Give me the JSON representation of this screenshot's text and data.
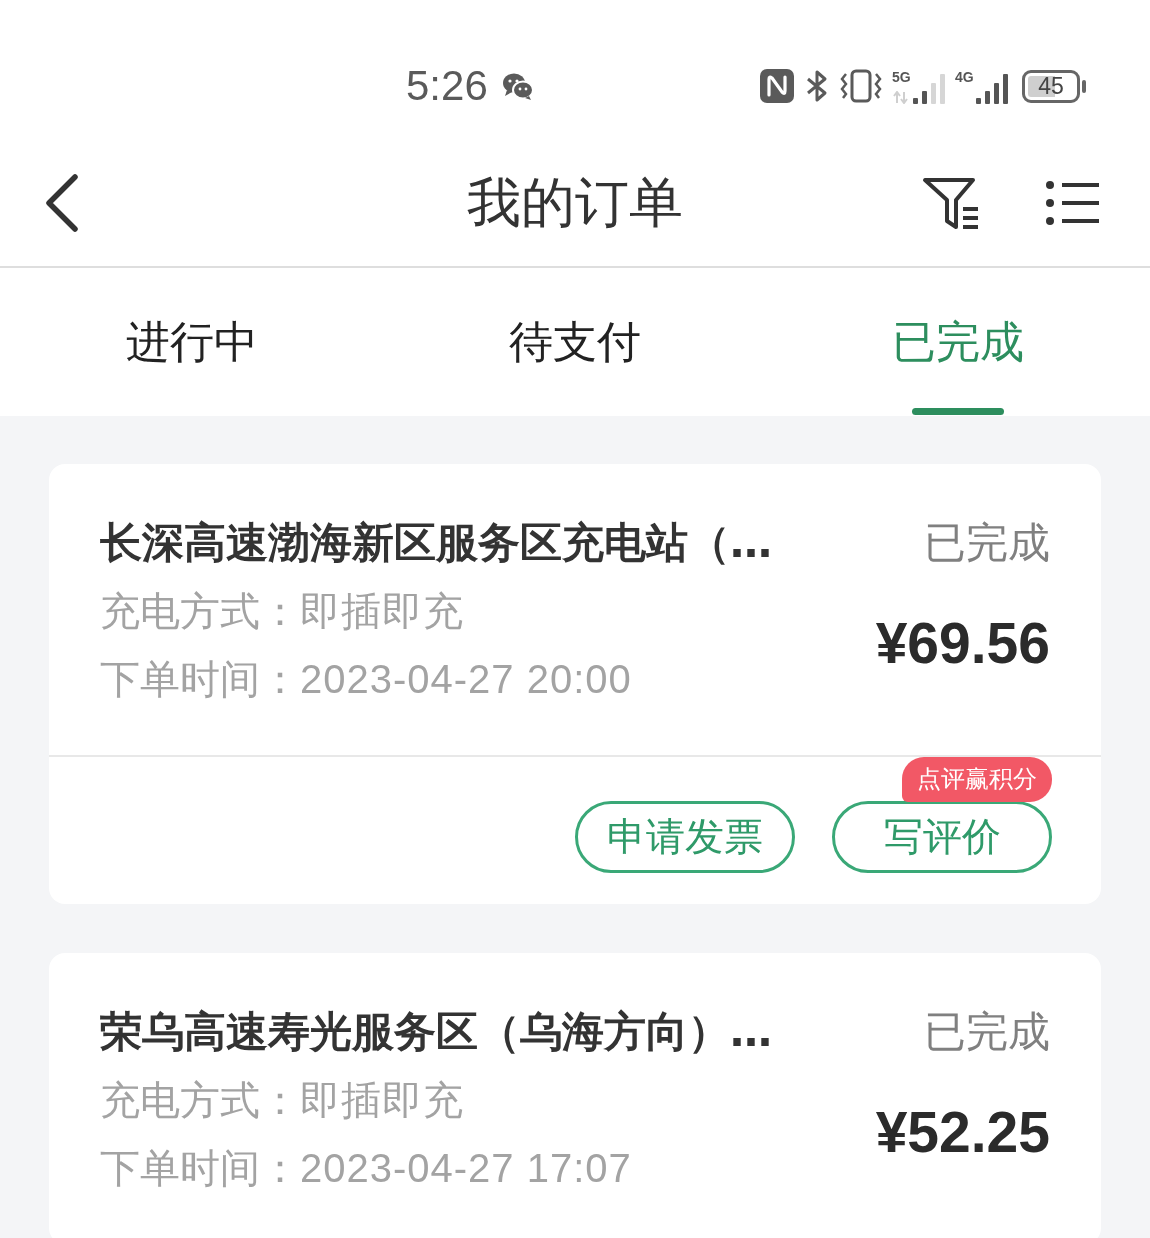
{
  "status_bar": {
    "time": "5:26",
    "signals": [
      {
        "kind": "mobile-data",
        "label": "5G"
      },
      {
        "kind": "signal",
        "label": "4G"
      }
    ],
    "battery": "45"
  },
  "header": {
    "title": "我的订单"
  },
  "tabs": [
    {
      "label": "进行中",
      "selected": false
    },
    {
      "label": "待支付",
      "selected": false
    },
    {
      "label": "已完成",
      "selected": true
    }
  ],
  "orders": [
    {
      "station": "长深高速渤海新区服务区充电站（…",
      "status": "已完成",
      "details": [
        {
          "label": "充电方式：",
          "value": "即插即充"
        },
        {
          "label": "下单时间：",
          "value": "2023-04-27 20:00"
        }
      ],
      "price": "¥69.56",
      "actions": [
        {
          "label": "申请发票"
        },
        {
          "label": "写评价",
          "badge": "点评赢积分"
        }
      ]
    },
    {
      "station": "荣乌高速寿光服务区（乌海方向）…",
      "status": "已完成",
      "details": [
        {
          "label": "充电方式：",
          "value": "即插即充"
        },
        {
          "label": "下单时间：",
          "value": "2023-04-27 17:07"
        }
      ],
      "price": "¥52.25"
    }
  ]
}
